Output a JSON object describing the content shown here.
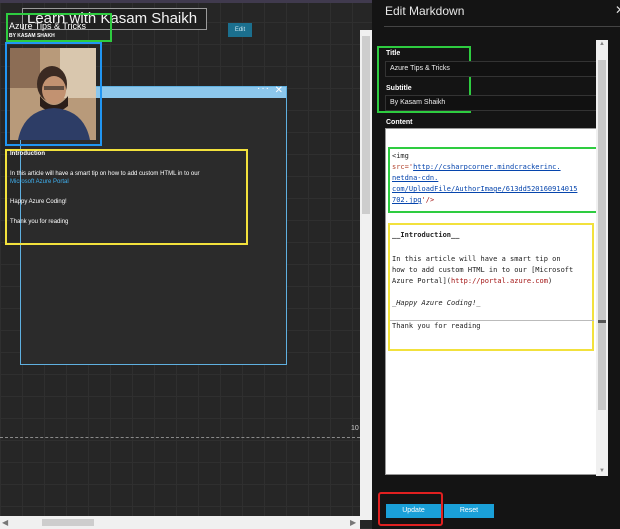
{
  "dashboard": {
    "title": "Learn with Kasam Shaikh",
    "page_marker": "10"
  },
  "tile": {
    "more_label": "···",
    "title": "Azure Tips & Tricks",
    "subtitle": "BY KASAM SHAKH",
    "edit_label": "Edit",
    "intro_heading": "Introduction",
    "para_text": "In this article will have a smart tip on how to add custom HTML in to our",
    "link_text": "Microsoft Azure Portal",
    "happy_text": "Happy Azure Coding!",
    "thanks_text": "Thank you for reading"
  },
  "editor": {
    "blade_title": "Edit Markdown",
    "title_label": "Title",
    "title_value": "Azure Tips & Tricks",
    "subtitle_label": "Subtitle",
    "subtitle_value": "By Kasam Shaikh",
    "content_label": "Content",
    "code": {
      "l1": "<img",
      "l2_attr": "src=",
      "l2_str": "'",
      "l2_link": "http://csharpcorner.mindcrackerinc.",
      "l3_link": "netdna-cdn.",
      "l4_link": "com/UploadFile/AuthorImage/613dd520160914015",
      "l5_link": "702.jpg",
      "l5_tail": "'/>",
      "intro": "__Introduction__",
      "p1": "In this article will have a smart tip on",
      "p2": "how to add custom HTML in to our [Microsoft",
      "p3_a": "Azure Portal](",
      "p3_link": "http://portal.azure.com",
      "p3_b": ")",
      "happy": "_Happy Azure Coding!_",
      "thanks": "Thank you for reading"
    },
    "update_label": "Update",
    "reset_label": "Reset"
  },
  "colors": {
    "accent": "#1aa0d8",
    "tile_header": "#8cc7ec",
    "annot_green": "#2ecc40",
    "annot_yellow": "#f2e13c",
    "annot_blue": "#2196f3",
    "annot_red": "#e02020"
  }
}
